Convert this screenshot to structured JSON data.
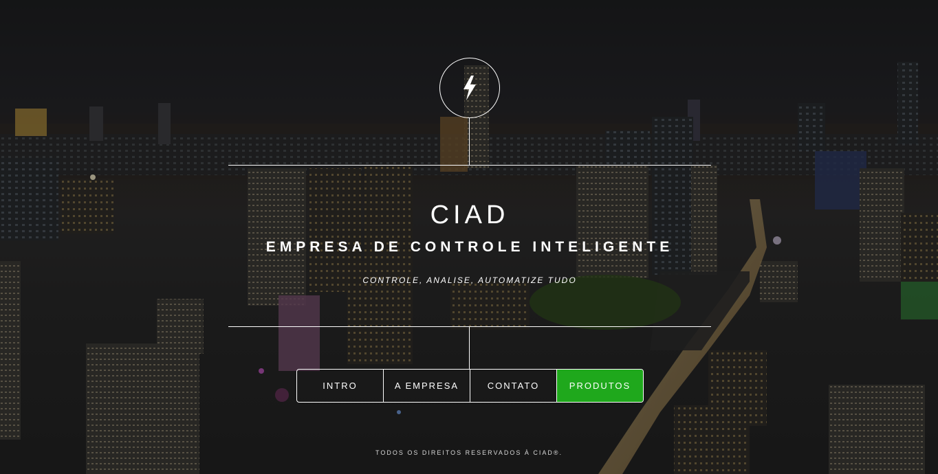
{
  "brand": {
    "title": "CIAD",
    "subtitle": "EMPRESA DE CONTROLE INTELIGENTE",
    "tagline": "CONTROLE, ANALISE, AUTOMATIZE TUDO",
    "logo_icon": "lightning-bolt-icon"
  },
  "nav": {
    "items": [
      {
        "label": "INTRO"
      },
      {
        "label": "A EMPRESA"
      },
      {
        "label": "CONTATO"
      },
      {
        "label": "PRODUTOS"
      }
    ],
    "active_color": "#1fa81c"
  },
  "footer": {
    "copyright": "TODOS OS DIREITOS RESERVADOS À CIAD®."
  }
}
